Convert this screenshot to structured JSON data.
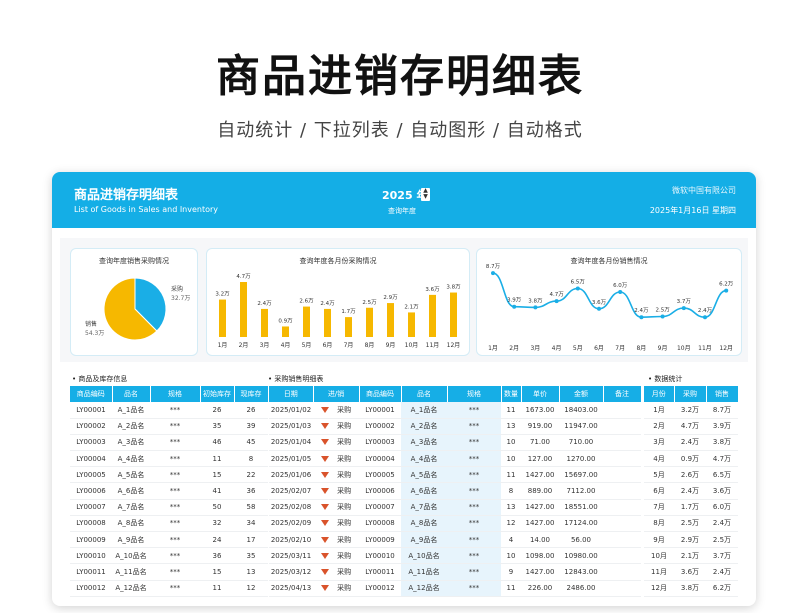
{
  "hero": {
    "title": "商品进销存明细表",
    "subtitle": "自动统计 / 下拉列表 / 自动图形 / 自动格式"
  },
  "banner": {
    "title": "商品进销存明细表",
    "subtitle": "List of Goods in Sales and Inventory",
    "year": "2025 年",
    "year_label": "查询年度",
    "company": "微软中国有限公司",
    "date": "2025年1月16日 星期四"
  },
  "colors": {
    "accent": "#14aee6",
    "bar": "#f6b800",
    "line": "#1aaee6",
    "highlight": "#e7f4fc",
    "arrow": "#d9532b"
  },
  "chart_data": [
    {
      "type": "pie",
      "title": "查询年度销售采购情况",
      "slices": [
        {
          "label": "采购",
          "value_label": "32.7万",
          "value": 32.7
        },
        {
          "label": "销售",
          "value_label": "54.3万",
          "value": 54.3
        }
      ]
    },
    {
      "type": "bar",
      "title": "查询年度各月份采购情况",
      "categories": [
        "1月",
        "2月",
        "3月",
        "4月",
        "5月",
        "6月",
        "7月",
        "8月",
        "9月",
        "10月",
        "11月",
        "12月"
      ],
      "values": [
        3.2,
        4.7,
        2.4,
        0.9,
        2.6,
        2.4,
        1.7,
        2.5,
        2.9,
        2.1,
        3.6,
        3.8
      ],
      "labels": [
        "3.2万",
        "4.7万",
        "2.4万",
        "0.9万",
        "2.6万",
        "2.4万",
        "1.7万",
        "2.5万",
        "2.9万",
        "2.1万",
        "3.6万",
        "3.8万"
      ]
    },
    {
      "type": "line",
      "title": "查询年度各月份销售情况",
      "categories": [
        "1月",
        "2月",
        "3月",
        "4月",
        "5月",
        "6月",
        "7月",
        "8月",
        "9月",
        "10月",
        "11月",
        "12月"
      ],
      "values": [
        8.7,
        3.9,
        3.8,
        4.7,
        6.5,
        3.6,
        6.0,
        2.4,
        2.5,
        3.7,
        2.4,
        6.2
      ],
      "labels": [
        "8.7万",
        "3.9万",
        "3.8万",
        "4.7万",
        "6.5万",
        "3.6万",
        "6.0万",
        "2.4万",
        "2.5万",
        "3.7万",
        "2.4万",
        "6.2万"
      ]
    }
  ],
  "inventory": {
    "section_title": "商品及库存信息",
    "headers": [
      "商品编码",
      "品名",
      "规格",
      "初始库存",
      "现库存"
    ],
    "rows": [
      [
        "LY00001",
        "A_1品名",
        "***",
        "26",
        "26"
      ],
      [
        "LY00002",
        "A_2品名",
        "***",
        "35",
        "39"
      ],
      [
        "LY00003",
        "A_3品名",
        "***",
        "46",
        "45"
      ],
      [
        "LY00004",
        "A_4品名",
        "***",
        "11",
        "8"
      ],
      [
        "LY00005",
        "A_5品名",
        "***",
        "15",
        "22"
      ],
      [
        "LY00006",
        "A_6品名",
        "***",
        "41",
        "36"
      ],
      [
        "LY00007",
        "A_7品名",
        "***",
        "50",
        "58"
      ],
      [
        "LY00008",
        "A_8品名",
        "***",
        "32",
        "34"
      ],
      [
        "LY00009",
        "A_9品名",
        "***",
        "24",
        "17"
      ],
      [
        "LY00010",
        "A_10品名",
        "***",
        "36",
        "35"
      ],
      [
        "LY00011",
        "A_11品名",
        "***",
        "15",
        "13"
      ],
      [
        "LY00012",
        "A_12品名",
        "***",
        "11",
        "12"
      ]
    ]
  },
  "purchase_sales": {
    "section_title": "采购销售明细表",
    "headers": [
      "日期",
      "进/销",
      "商品编码",
      "品名",
      "规格",
      "数量",
      "单价",
      "金额",
      "备注"
    ],
    "rows": [
      [
        "2025/01/02",
        "采购",
        "LY00001",
        "A_1品名",
        "***",
        "11",
        "1673.00",
        "18403.00",
        ""
      ],
      [
        "2025/01/03",
        "采购",
        "LY00002",
        "A_2品名",
        "***",
        "13",
        "919.00",
        "11947.00",
        ""
      ],
      [
        "2025/01/04",
        "采购",
        "LY00003",
        "A_3品名",
        "***",
        "10",
        "71.00",
        "710.00",
        ""
      ],
      [
        "2025/01/05",
        "采购",
        "LY00004",
        "A_4品名",
        "***",
        "10",
        "127.00",
        "1270.00",
        ""
      ],
      [
        "2025/01/06",
        "采购",
        "LY00005",
        "A_5品名",
        "***",
        "11",
        "1427.00",
        "15697.00",
        ""
      ],
      [
        "2025/02/07",
        "采购",
        "LY00006",
        "A_6品名",
        "***",
        "8",
        "889.00",
        "7112.00",
        ""
      ],
      [
        "2025/02/08",
        "采购",
        "LY00007",
        "A_7品名",
        "***",
        "13",
        "1427.00",
        "18551.00",
        ""
      ],
      [
        "2025/02/09",
        "采购",
        "LY00008",
        "A_8品名",
        "***",
        "12",
        "1427.00",
        "17124.00",
        ""
      ],
      [
        "2025/02/10",
        "采购",
        "LY00009",
        "A_9品名",
        "***",
        "4",
        "14.00",
        "56.00",
        ""
      ],
      [
        "2025/03/11",
        "采购",
        "LY00010",
        "A_10品名",
        "***",
        "10",
        "1098.00",
        "10980.00",
        ""
      ],
      [
        "2025/03/12",
        "采购",
        "LY00011",
        "A_11品名",
        "***",
        "9",
        "1427.00",
        "12843.00",
        ""
      ],
      [
        "2025/04/13",
        "采购",
        "LY00012",
        "A_12品名",
        "***",
        "11",
        "226.00",
        "2486.00",
        ""
      ]
    ]
  },
  "stats": {
    "section_title": "数据统计",
    "headers": [
      "月份",
      "采购",
      "销售"
    ],
    "rows": [
      [
        "1月",
        "3.2万",
        "8.7万"
      ],
      [
        "2月",
        "4.7万",
        "3.9万"
      ],
      [
        "3月",
        "2.4万",
        "3.8万"
      ],
      [
        "4月",
        "0.9万",
        "4.7万"
      ],
      [
        "5月",
        "2.6万",
        "6.5万"
      ],
      [
        "6月",
        "2.4万",
        "3.6万"
      ],
      [
        "7月",
        "1.7万",
        "6.0万"
      ],
      [
        "8月",
        "2.5万",
        "2.4万"
      ],
      [
        "9月",
        "2.9万",
        "2.5万"
      ],
      [
        "10月",
        "2.1万",
        "3.7万"
      ],
      [
        "11月",
        "3.6万",
        "2.4万"
      ],
      [
        "12月",
        "3.8万",
        "6.2万"
      ]
    ]
  }
}
